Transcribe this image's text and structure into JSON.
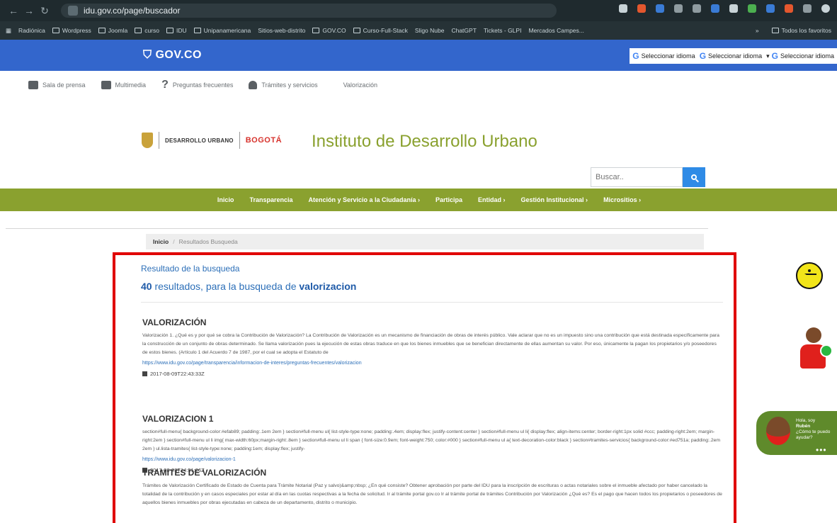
{
  "browser": {
    "url": "idu.gov.co/page/buscador",
    "bookmarks": [
      "Radiónica",
      "Wordpress",
      "Joomla",
      "curso",
      "IDU",
      "Unipanamericana",
      "Sitios-web-distrito",
      "GOV.CO",
      "Curso-Full-Stack",
      "Sligo Nube",
      "ChatGPT",
      "Tickets - GLPI",
      "Mercados Campes..."
    ],
    "bookmarks_more": "»",
    "all_bookmarks": "Todos los favoritos"
  },
  "govbar": {
    "logo": "GOV.CO",
    "lang_label": "Seleccionar idioma"
  },
  "utility": {
    "items": [
      "Sala de prensa",
      "Multimedia",
      "Preguntas frecuentes",
      "Trámites y servicios",
      "Valorización"
    ]
  },
  "branding": {
    "idu_text": "DESARROLLO URBANO",
    "bogota_text": "BOGOTÁ",
    "site_title": "Instituto de Desarrollo Urbano"
  },
  "search": {
    "placeholder": "Buscar.."
  },
  "nav": {
    "items": [
      "Inicio",
      "Transparencia",
      "Atención y Servicio a la Ciudadanía ›",
      "Participa",
      "Entidad ›",
      "Gestión Institucional ›",
      "Micrositios ›"
    ]
  },
  "breadcrumb": {
    "home": "Inicio",
    "separator": "/",
    "current": "Resultados Busqueda"
  },
  "results": {
    "heading": "Resultado de la busqueda",
    "count": "40",
    "count_text": " resultados, para la busqueda de ",
    "query": "valorizacion",
    "items": [
      {
        "title": "VALORIZACIÓN",
        "desc": "Valorización 1. ¿Qué es y por qué se cobra la Contribución de Valorización? La Contribución de Valorización es un mecanismo de financiación de obras de interés público. Vale aclarar que no es un impuesto sino una contribución que está destinada específicamente para la construcción de un conjunto de obras determinado. Se llama valorización pues la ejecución de estas obras traduce en que los bienes inmuebles que se benefician directamente de ellas aumentan su valor. Por eso, únicamente la pagan los propietarios y/o poseedores de estos bienes. (Artículo 1 del Acuerdo 7 de 1987, por el cual se adopta el Estatuto de",
        "link": "https://www.idu.gov.co/page/transparencia/informacion-de-interes/preguntas-frecuentes/valorizacion",
        "date": "2017-08-09T22:43:33Z"
      },
      {
        "title": "VALORIZACION 1",
        "desc": "section#full-menu{ background-color:#efab89; padding:.1em 2em } section#full-menu ul{ list-style-type:none; padding:.4em; display:flex; justify-content:center } section#full-menu ul li{ display:flex; align-items:center; border-right:1px solid #ccc; padding-right:2em; margin-right:2em } section#full-menu ul li img{ max-width:60px;margin-right:.8em } section#full-menu ul li span { font-size:0.9em; font-weight:750; color:#000 } section#full-menu ul a{ text-decoration-color:black } section#tramites-servicios{ background-color:#ed751a; padding:.2em 2em } ul.lista-tramites{ list-style-type:none; padding:1em; display:flex; justify-",
        "link": "https://www.idu.gov.co/page/valorizacion-1",
        "date": "2017-08-23T14:51:26Z"
      },
      {
        "title": "TRAMITES DE VALORIZACIÓN",
        "desc": "Trámites de Valorización Certificado de Estado de Cuenta para Trámite Notarial (Paz y salvo)&amp;nbsp; ¿En qué consiste? Obtener aprobación por parte del IDU para la inscripción de escrituras o actas notariales sobre el inmueble afectado por haber cancelado la totalidad de la contribución y en casos especiales por estar al día en las cuotas respectivas a la fecha de solicitud. Ir al trámite portal gov.co Ir al trámite portal de trámites Contribución por Valorización ¿Qué es? Es el pago que hacen todos los propietarios o poseedores de aquellos bienes inmuebles por obras ejecutadas en cabeza de un departamento, distrito o municipio."
      }
    ]
  },
  "chat": {
    "greeting": "Hola, soy",
    "name": "Rubén",
    "question": "¿Cómo te puedo ayudar?",
    "more": "•••"
  }
}
